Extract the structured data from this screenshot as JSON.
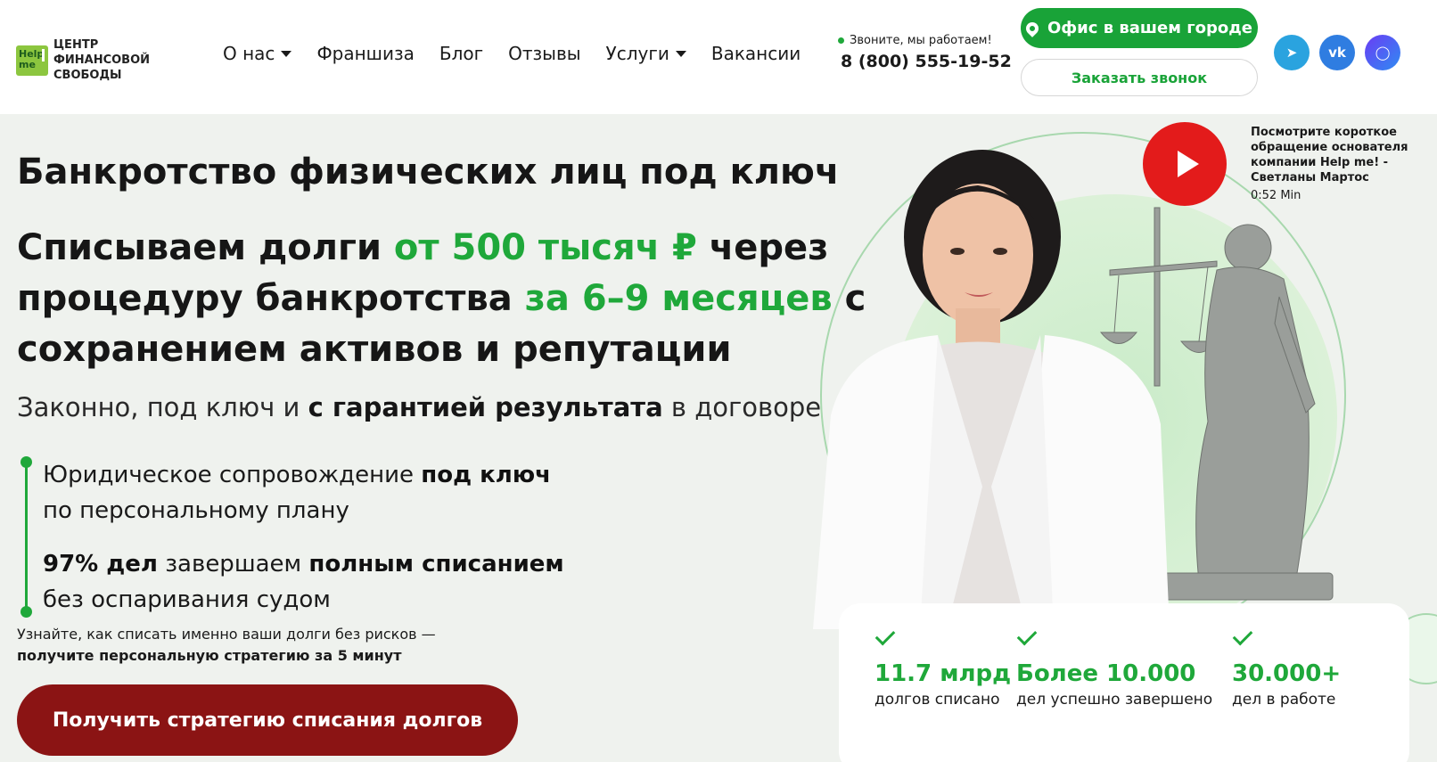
{
  "header": {
    "logo": {
      "mark_top": "Help",
      "mark_bottom": "me",
      "text": "Центр финансовой свободы"
    },
    "nav": [
      {
        "label": "О нас",
        "dropdown": true
      },
      {
        "label": "Франшиза",
        "dropdown": false
      },
      {
        "label": "Блог",
        "dropdown": false
      },
      {
        "label": "Отзывы",
        "dropdown": false
      },
      {
        "label": "Услуги",
        "dropdown": true
      },
      {
        "label": "Вакансии",
        "dropdown": false
      }
    ],
    "contact": {
      "note": "Звоните, мы работаем!",
      "phone": "8 (800) 555-19-52"
    },
    "office_button": "Офис в вашем городе",
    "callback_button": "Заказать звонок",
    "social": [
      {
        "name": "telegram-icon",
        "glyph": "➤"
      },
      {
        "name": "vk-icon",
        "glyph": "vk"
      },
      {
        "name": "max-messenger-icon",
        "glyph": "◯"
      }
    ]
  },
  "hero": {
    "title": "Банкротство физических лиц под ключ",
    "headline": {
      "p1": "Списываем долги ",
      "g1": "от 500 тысяч ₽",
      "p2": " через процедуру банкротства ",
      "g2": "за 6–9 месяцев",
      "p3": " с сохранением активов и репутации"
    },
    "subtitle": {
      "p1": "Законно, под ключ и ",
      "bold": "с гарантией результата",
      "p2": " в договоре"
    },
    "bullets": [
      {
        "p1": "Юридическое сопровождение ",
        "bold": "под ключ",
        "line2": "по персональному плану"
      },
      {
        "bold1": "97% дел",
        "p1": " завершаем ",
        "bold2": "полным списанием",
        "line2": "без оспаривания судом"
      }
    ],
    "cta_note": {
      "line1": "Узнайте, как списать именно ваши долги без рисков —",
      "line2": "получите персональную стратегию за 5 минут"
    },
    "cta_button": "Получить стратегию списания долгов",
    "video": {
      "text": "Посмотрите короткое обращение основателя компании Help me! - Светланы Мартос",
      "duration": "0:52 Min"
    },
    "stats": [
      {
        "value": "11.7 млрд",
        "label": "долгов списано"
      },
      {
        "value": "Более 10.000",
        "label": "дел успешно завершено"
      },
      {
        "value": "30.000+",
        "label": "дел в работе"
      }
    ]
  },
  "colors": {
    "accent": "#1fa83a",
    "cta": "#8b1414",
    "play": "#e31b1b",
    "hero_bg": "#eff2ee"
  }
}
